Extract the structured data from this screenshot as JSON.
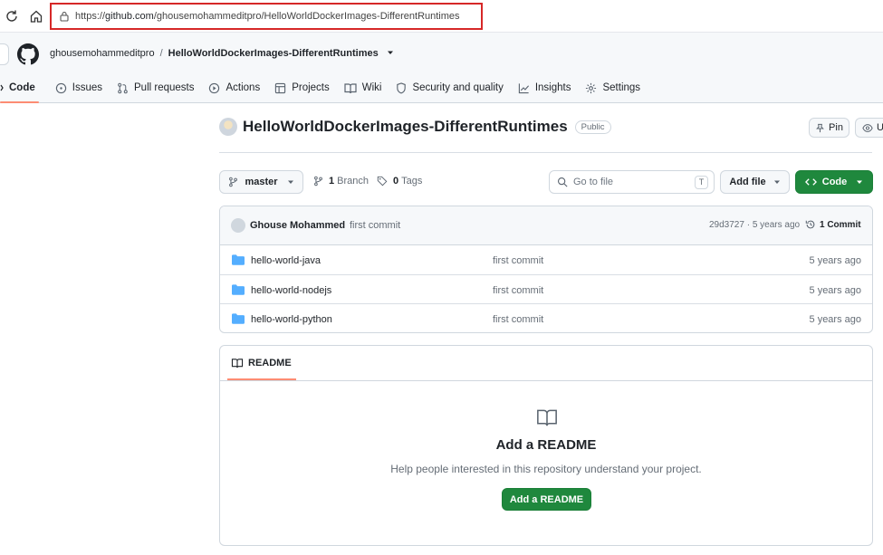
{
  "browser": {
    "url_prefix": "https://",
    "url_host": "github.com",
    "url_path": "/ghousemohammeditpro/HelloWorldDockerImages-DifferentRuntimes"
  },
  "header": {
    "owner": "ghousemohammeditpro",
    "separator": "/",
    "repo": "HelloWorldDockerImages-DifferentRuntimes",
    "nav": [
      {
        "label": "Code",
        "icon": "code-icon"
      },
      {
        "label": "Issues",
        "icon": "issue-icon"
      },
      {
        "label": "Pull requests",
        "icon": "pull-request-icon"
      },
      {
        "label": "Actions",
        "icon": "play-icon"
      },
      {
        "label": "Projects",
        "icon": "table-icon"
      },
      {
        "label": "Wiki",
        "icon": "book-icon"
      },
      {
        "label": "Security and quality",
        "icon": "shield-icon"
      },
      {
        "label": "Insights",
        "icon": "graph-icon"
      },
      {
        "label": "Settings",
        "icon": "gear-icon"
      }
    ]
  },
  "repo": {
    "title": "HelloWorldDockerImages-DifferentRuntimes",
    "visibility": "Public",
    "pin_label": "Pin",
    "unwatch_label": "Ur"
  },
  "toolbar": {
    "branch": "master",
    "branches_count": "1",
    "branches_label": "Branch",
    "tags_count": "0",
    "tags_label": "Tags",
    "goto_placeholder": "Go to file",
    "goto_key": "T",
    "add_file": "Add file",
    "code": "Code"
  },
  "commit": {
    "author": "Ghouse Mohammed",
    "message": "first commit",
    "hash_age": "29d3727 · 5 years ago",
    "count": "1 Commit"
  },
  "files": [
    {
      "name": "hello-world-java",
      "message": "first commit",
      "age": "5 years ago"
    },
    {
      "name": "hello-world-nodejs",
      "message": "first commit",
      "age": "5 years ago"
    },
    {
      "name": "hello-world-python",
      "message": "first commit",
      "age": "5 years ago"
    }
  ],
  "readme": {
    "tab": "README",
    "title": "Add a README",
    "subtitle": "Help people interested in this repository understand your project.",
    "button": "Add a README"
  },
  "colors": {
    "accent_green": "#1f883d",
    "tab_underline": "#fd8c73",
    "folder_blue": "#54aeff",
    "highlight_red": "#d62828"
  }
}
